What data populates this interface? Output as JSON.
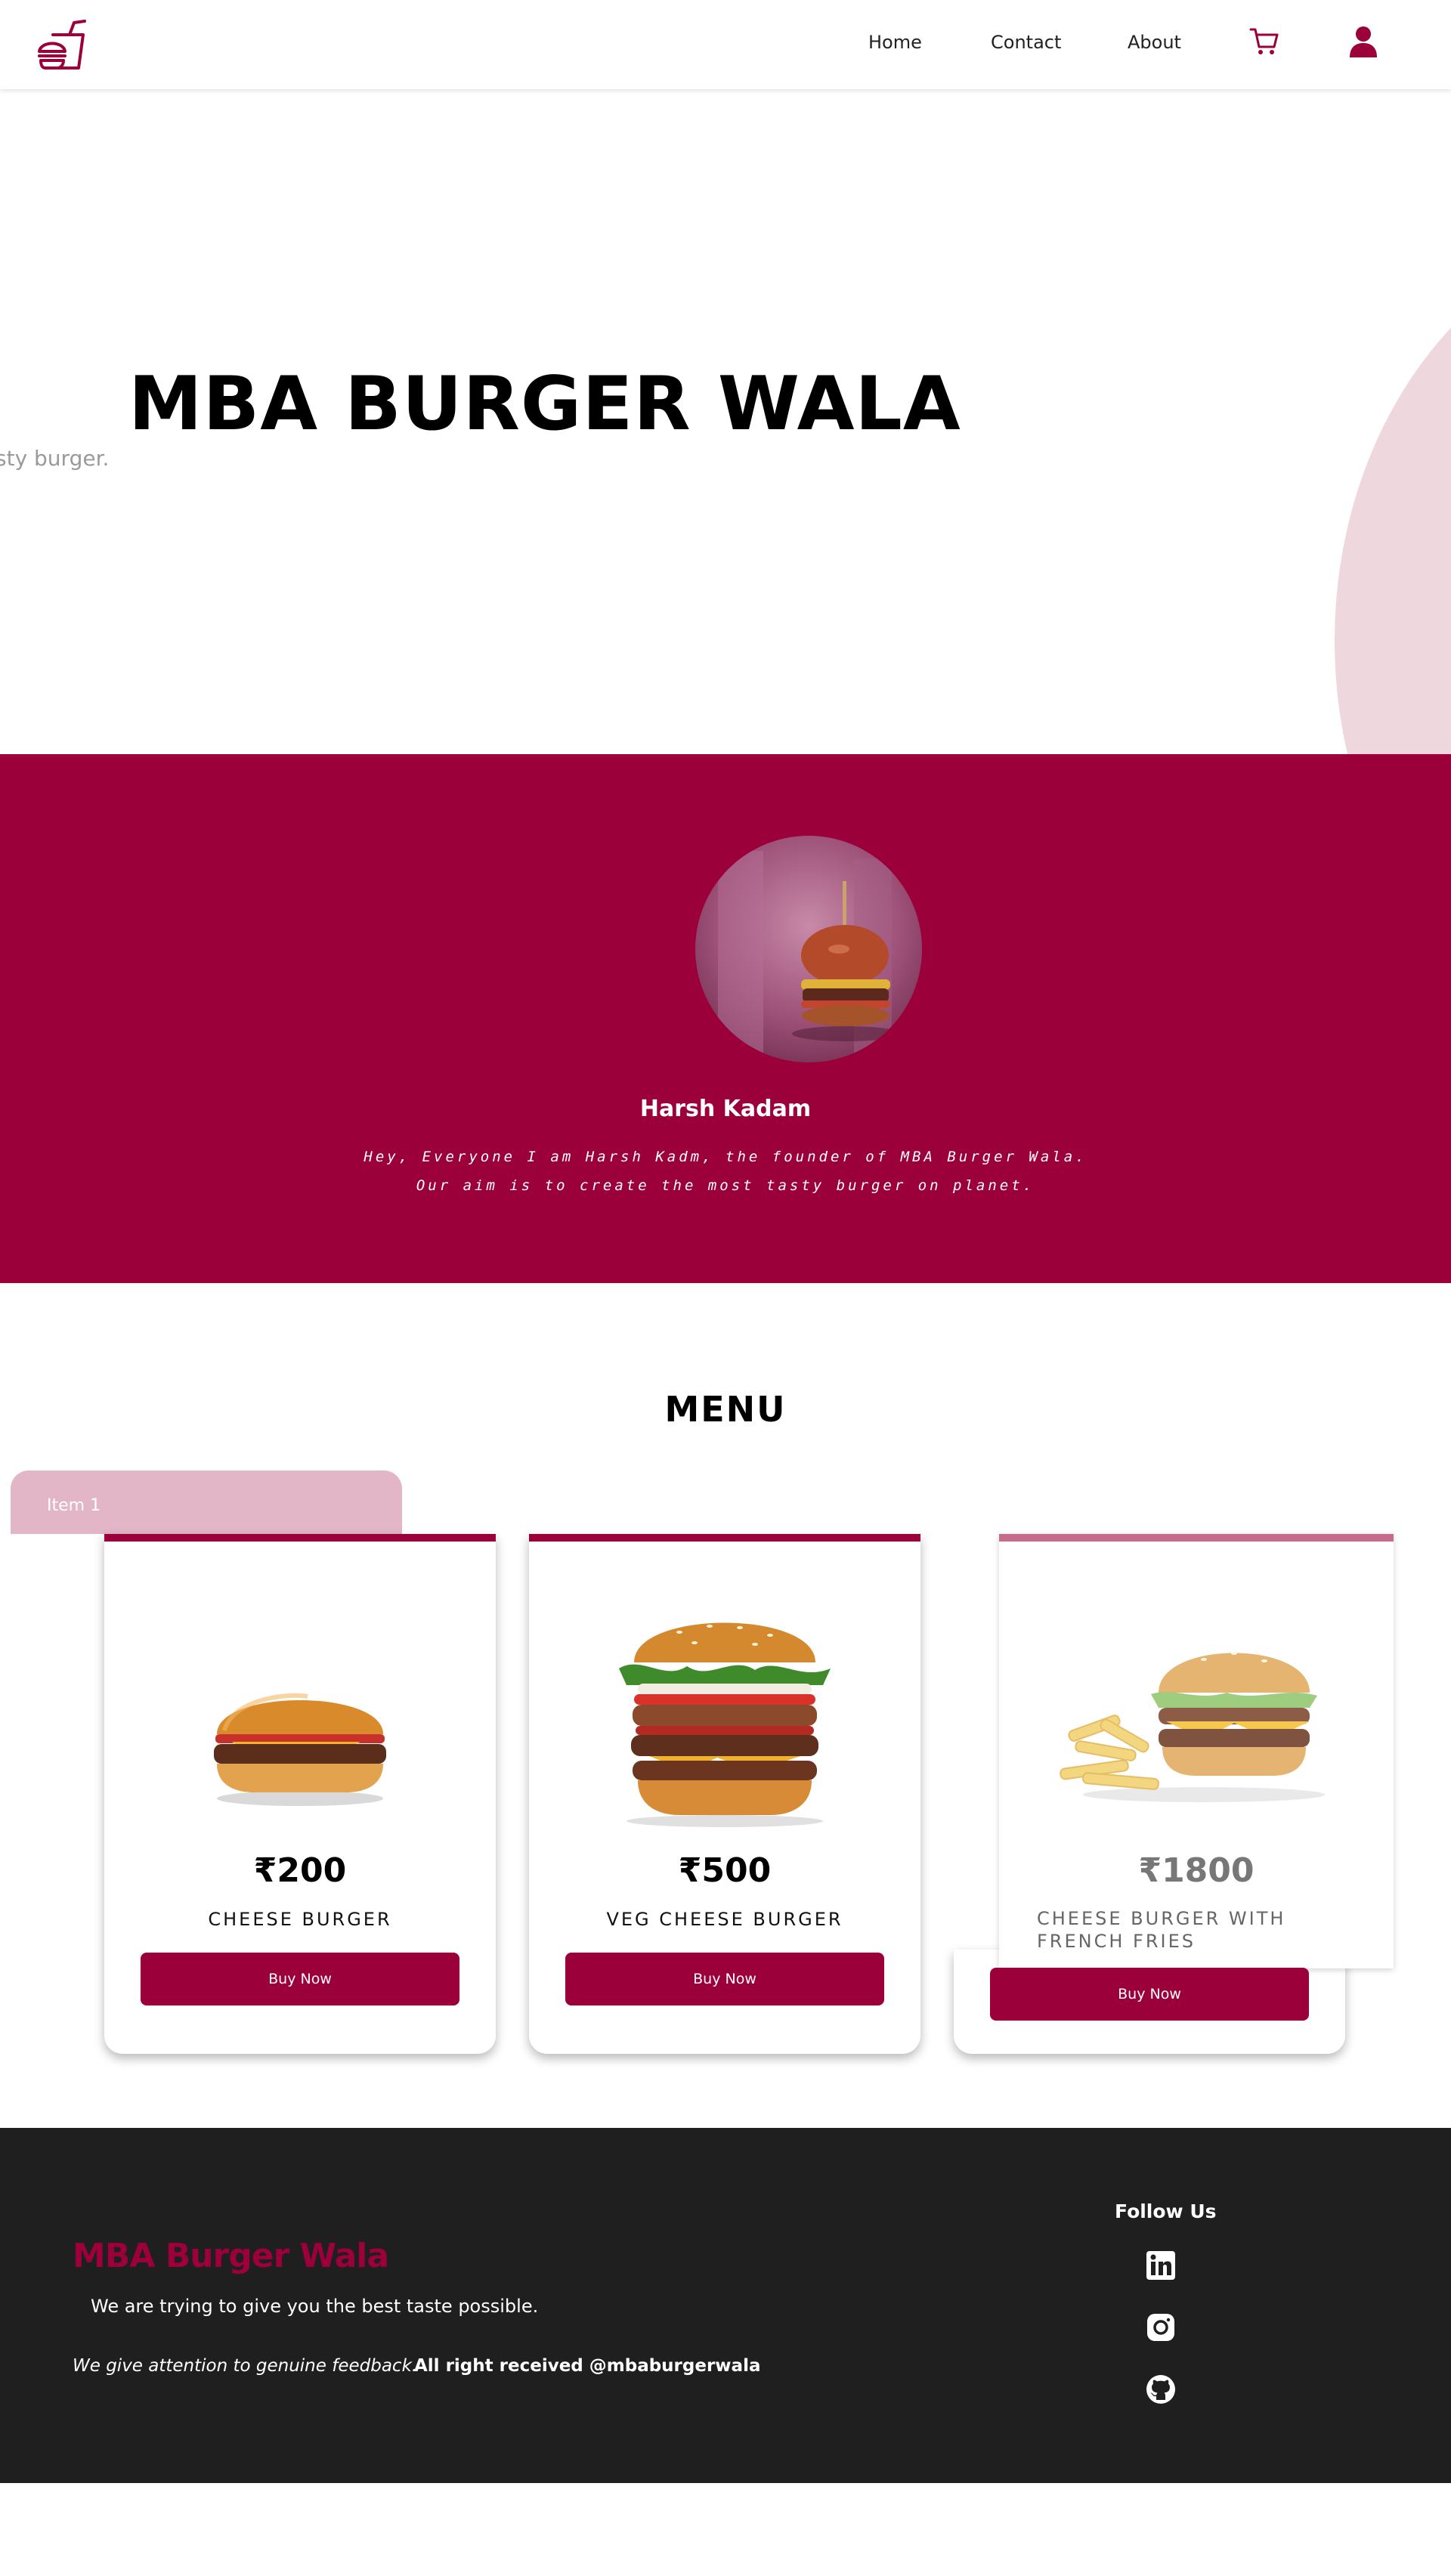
{
  "nav": {
    "brand_icon": "burger-logo-icon",
    "links": [
      "Home",
      "Contact",
      "About"
    ],
    "cart_icon": "cart-icon",
    "user_icon": "user-icon",
    "accent": "#9b003a"
  },
  "hero": {
    "title": "MBA BURGER WALA",
    "subtitle": "sty burger."
  },
  "founder": {
    "name": "Harsh Kadam",
    "bio_line1": "Hey, Everyone I am Harsh Kadm, the founder of MBA Burger Wala.",
    "bio_line2": "Our aim is to create the most tasty burger on planet.",
    "background": "#9b003a"
  },
  "menu": {
    "title": "MENU",
    "tab_label": "Item 1",
    "items": [
      {
        "price": "₹200",
        "name": "CHEESE BURGER",
        "button": "Buy Now"
      },
      {
        "price": "₹500",
        "name": "VEG CHEESE BURGER",
        "button": "Buy Now"
      },
      {
        "price": "₹1800",
        "name": "CHEESE BURGER WITH FRENCH FRIES",
        "button": "Buy Now"
      }
    ]
  },
  "footer": {
    "brand": "MBA Burger Wala",
    "tagline": "We are trying to give you the best taste possible.",
    "feedback": "We give attention to genuine feedback.",
    "rights": "All right received @mbaburgerwala",
    "follow_title": "Follow Us",
    "socials": [
      "linkedin-icon",
      "instagram-icon",
      "github-icon"
    ],
    "background": "#1f1f1f"
  }
}
